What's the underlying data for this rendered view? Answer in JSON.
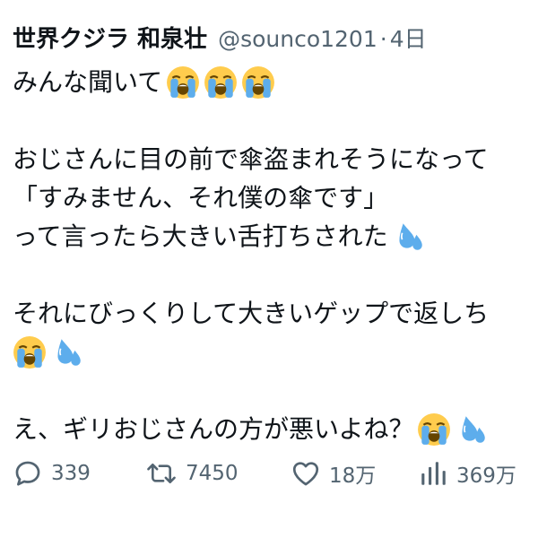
{
  "header": {
    "display_name": "世界クジラ 和泉壮",
    "handle": "@sounco1201",
    "separator": "·",
    "time": "4日"
  },
  "body": {
    "line1": "みんな聞いて",
    "line2": "おじさんに目の前で傘盗まれそうになって",
    "line3": "「すみません、それ僕の傘です」",
    "line4": "って言ったら大きい舌打ちされた",
    "line5": "それにびっくりして大きいゲップで返しち",
    "line7": "え、ギリおじさんの方が悪いよね？"
  },
  "icons": {
    "crying": "loudly-crying-face-emoji",
    "sweat": "sweat-droplets-emoji",
    "reply": "reply-icon",
    "retweet": "retweet-icon",
    "like": "heart-icon",
    "views": "views-bar-chart-icon"
  },
  "actions": {
    "reply_count": "339",
    "retweet_count": "7450",
    "like_count": "18万",
    "views_count": "369万"
  },
  "colors": {
    "text": "#0f1419",
    "secondary": "#536471",
    "emoji_yellow": "#ffcc4d",
    "emoji_tear": "#5dadec",
    "drop_blue": "#5dadec"
  }
}
